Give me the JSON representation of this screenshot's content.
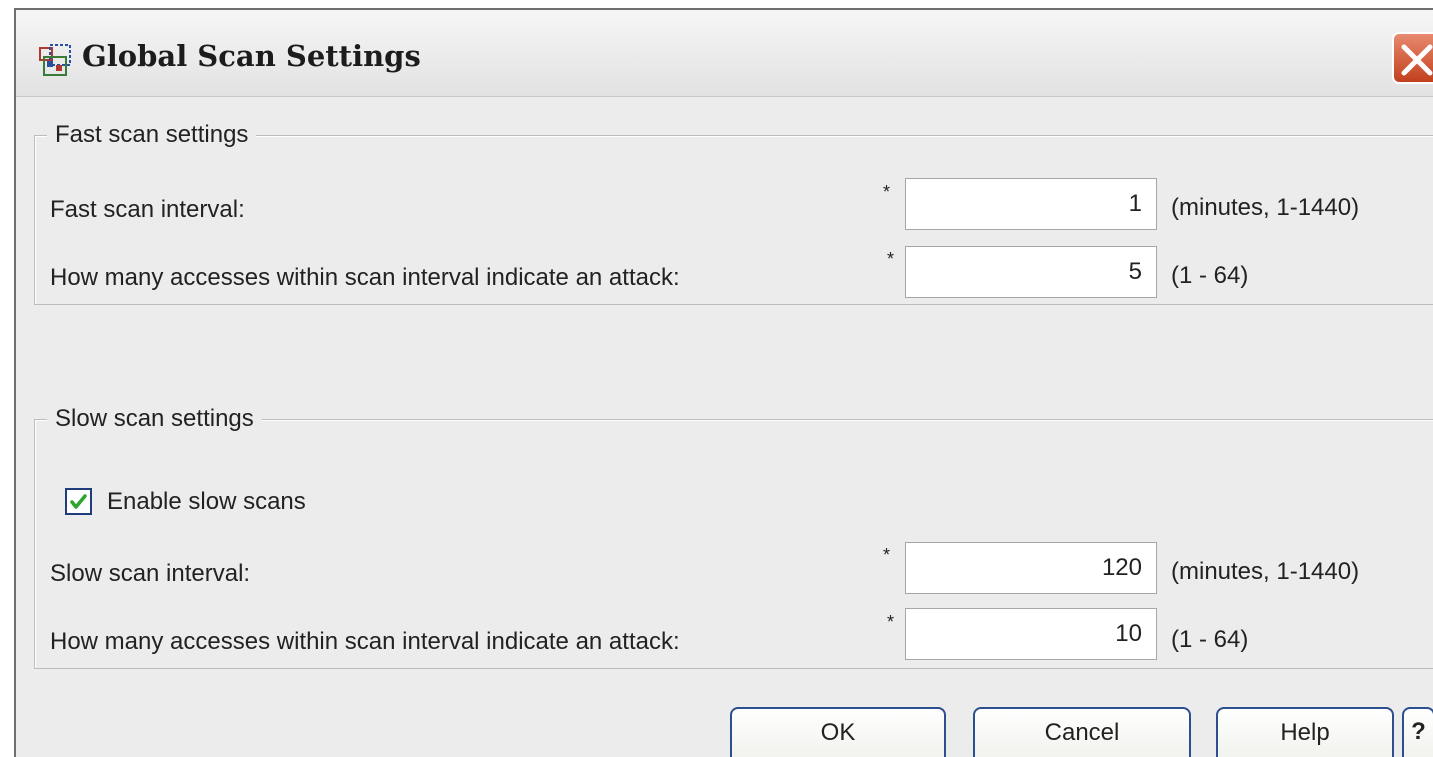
{
  "window": {
    "title": "Global Scan Settings",
    "icon": "settings-grid-icon"
  },
  "fast_scan": {
    "legend": "Fast scan settings",
    "interval_label": "Fast scan interval:",
    "interval_value": "1",
    "interval_unit": "(minutes, 1-1440)",
    "accesses_label": "How many accesses within scan interval indicate an attack:",
    "accesses_value": "5",
    "accesses_unit": "(1 - 64)"
  },
  "slow_scan": {
    "legend": "Slow scan settings",
    "enable_label": "Enable slow scans",
    "enable_checked": true,
    "interval_label": "Slow scan interval:",
    "interval_value": "120",
    "interval_unit": "(minutes, 1-1440)",
    "accesses_label": "How many accesses within scan interval indicate an attack:",
    "accesses_value": "10",
    "accesses_unit": "(1 - 64)"
  },
  "required_marker": "*",
  "buttons": {
    "ok": "OK",
    "cancel": "Cancel",
    "help": "Help",
    "context_help": "?"
  },
  "colors": {
    "close_button": "#c2401e",
    "button_border": "#2b4f8f",
    "checkmark": "#2fa52f"
  }
}
